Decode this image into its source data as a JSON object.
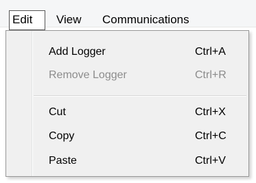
{
  "menubar": {
    "items": [
      {
        "label": "Edit"
      },
      {
        "label": "View"
      },
      {
        "label": "Communications"
      }
    ]
  },
  "edit_menu": {
    "items": [
      {
        "label": "Add Logger",
        "shortcut": "Ctrl+A",
        "enabled": true
      },
      {
        "label": "Remove Logger",
        "shortcut": "Ctrl+R",
        "enabled": false
      },
      {
        "label": "Cut",
        "shortcut": "Ctrl+X",
        "enabled": true
      },
      {
        "label": "Copy",
        "shortcut": "Ctrl+C",
        "enabled": true
      },
      {
        "label": "Paste",
        "shortcut": "Ctrl+V",
        "enabled": true
      }
    ]
  },
  "colors": {
    "menubar_bg": "#f5f6f7",
    "menu_bg": "#f0f0f0",
    "disabled_text": "#8c8c8c"
  }
}
